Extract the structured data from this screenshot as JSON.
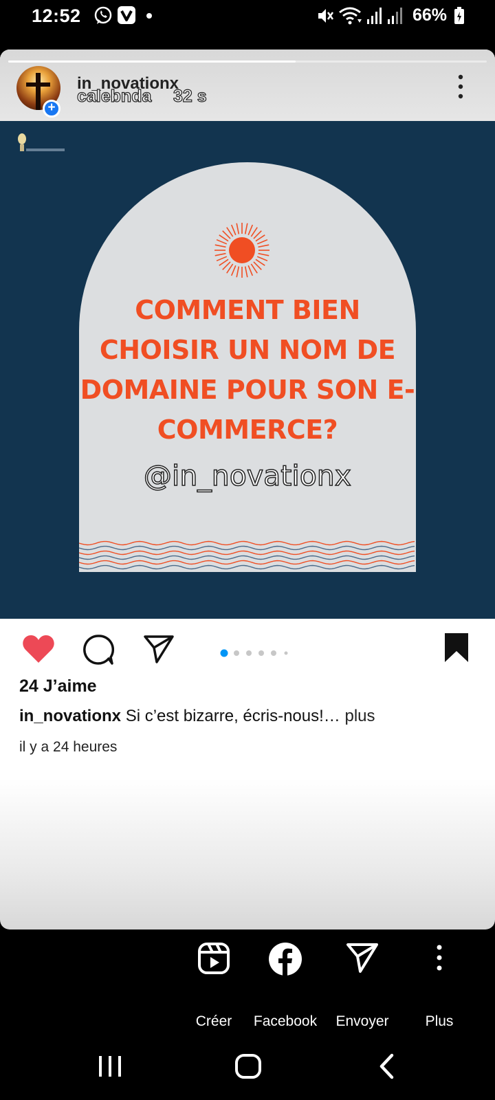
{
  "status_bar": {
    "time": "12:52",
    "battery": "66%",
    "icons": [
      "whatsapp-icon",
      "vivo-icon",
      "notification-dot",
      "mute-icon",
      "wifi-icon",
      "signal-icon",
      "signal-icon",
      "battery-charging-icon"
    ]
  },
  "story": {
    "account_name": "in_novationx",
    "sharer_name": "calebnda",
    "elapsed": "32 s",
    "progress": 0.6
  },
  "post": {
    "headline": "COMMENT BIEN CHOISIR UN NOM DE DOMAINE POUR SON E-COMMERCE?",
    "handle": "@in_novationx",
    "likes": "24 J’aime",
    "caption_user": "in_novationx",
    "caption_text": "Si c’est bizarre, écris-nous!…",
    "caption_more": "plus",
    "time_ago": "il y a 24 heures",
    "carousel": {
      "count": 6,
      "active_index": 0
    },
    "colors": {
      "background": "#12344f",
      "accent": "#f04e23",
      "arch": "#dcdee0",
      "like": "#ed4956",
      "active_dot": "#0095f6"
    }
  },
  "share_sheet": {
    "items": [
      {
        "label": "Créer",
        "icon": "reels-icon"
      },
      {
        "label": "Facebook",
        "icon": "facebook-icon"
      },
      {
        "label": "Envoyer",
        "icon": "send-icon"
      },
      {
        "label": "Plus",
        "icon": "more-vertical-icon"
      }
    ]
  },
  "nav_bar": {
    "buttons": [
      "recents-icon",
      "home-icon",
      "back-icon"
    ]
  }
}
